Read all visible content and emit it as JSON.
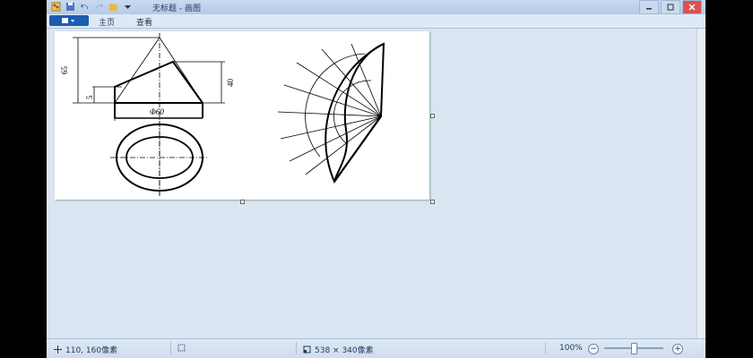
{
  "window": {
    "title": "无标题 - 画图"
  },
  "ribbon": {
    "paint_menu_icon": "paint-menu-icon",
    "tabs": [
      {
        "label": "主页"
      },
      {
        "label": "查看"
      }
    ]
  },
  "drawing": {
    "dim_65": "65",
    "dim_5": "5",
    "dim_40": "40",
    "dim_diameter": "Φ60"
  },
  "status": {
    "cursor_position": "110, 160像素",
    "canvas_size": "538 × 340像素",
    "zoom": "100%"
  },
  "colors": {
    "window_bg": "#dbe5f1",
    "ribbon_accent": "#1c5db0"
  }
}
